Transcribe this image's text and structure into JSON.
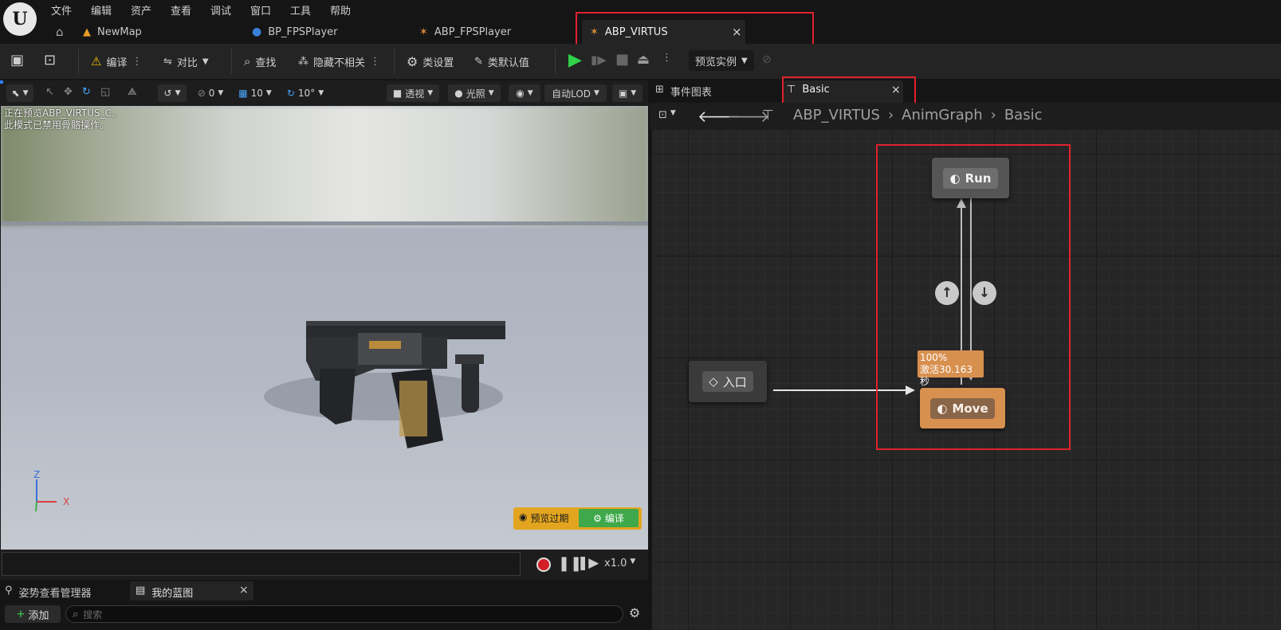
{
  "menu": [
    "文件",
    "编辑",
    "资产",
    "查看",
    "调试",
    "窗口",
    "工具",
    "帮助"
  ],
  "logo_letter": "U",
  "tabs": [
    {
      "label": "NewMap"
    },
    {
      "label": "BP_FPSPlayer"
    },
    {
      "label": "ABP_FPSPlayer"
    },
    {
      "label": "ABP_VIRTUS",
      "close": "×"
    }
  ],
  "toolbar": {
    "compile": "编译",
    "diff": "对比",
    "find": "查找",
    "hide_unrelated": "隐藏不相关",
    "class_settings": "类设置",
    "class_defaults": "类默认值",
    "preview_instance": "预览实例"
  },
  "viewport_bar": {
    "snap_rot": "0",
    "grid": "10",
    "angle": "10°",
    "perspective": "透视",
    "lighting": "光照",
    "lod": "自动LOD"
  },
  "viewport": {
    "overlay_line1": "正在预览ABP_VIRTUS_C。",
    "overlay_line2": "此模式已禁用骨骼操作。",
    "axis_z": "Z",
    "axis_x": "X",
    "preview_expired": "预览过期",
    "compile_btn": "编译"
  },
  "playback": {
    "speed": "x1.0"
  },
  "bottom_tabs": {
    "pose_manager": "姿势查看管理器",
    "my_blueprint": "我的蓝图",
    "close": "×",
    "add": "添加",
    "search_placeholder": "搜索"
  },
  "graph_tabs": {
    "event_graph": "事件图表",
    "basic": "Basic",
    "close": "×"
  },
  "breadcrumb": [
    "ABP_VIRTUS",
    "AnimGraph",
    "Basic"
  ],
  "graph": {
    "entry": "入口",
    "run": "Run",
    "move": "Move",
    "move_weight": "100%",
    "move_active": "激活30.163秒"
  },
  "colors": {
    "accent_orange": "#d8904f",
    "red_highlight": "#e0222c",
    "play_green": "#2fd34a",
    "preview_yellow": "#e3a51f",
    "compile_green": "#3ea84a"
  }
}
